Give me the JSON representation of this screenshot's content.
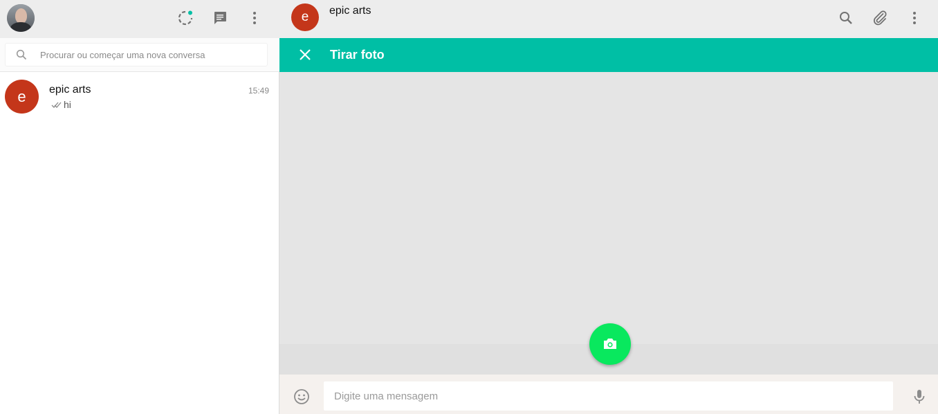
{
  "sidebar": {
    "header": {
      "avatar_icon": "user-avatar-photo",
      "icons": [
        "status-icon",
        "new-chat-icon",
        "menu-icon"
      ],
      "status_dot_color": "#00bfa5"
    },
    "search": {
      "placeholder": "Procurar ou começar uma nova conversa",
      "icon": "search-icon"
    },
    "chats": [
      {
        "avatar_letter": "e",
        "avatar_color": "#c4361a",
        "name": "epic arts",
        "time": "15:49",
        "status_icon": "double-check-icon",
        "preview": "hi"
      }
    ]
  },
  "conversation": {
    "header": {
      "avatar_letter": "e",
      "avatar_color": "#c4361a",
      "name": "epic arts",
      "icons": [
        "search-icon",
        "attach-icon",
        "menu-icon"
      ]
    },
    "photo_panel": {
      "title": "Tirar foto",
      "close_icon": "close-icon",
      "bar_color": "#00bfa5",
      "capture_button_icon": "camera-icon",
      "capture_button_color": "#09e85e"
    },
    "compose": {
      "emoji_icon": "emoji-icon",
      "placeholder": "Digite uma mensagem",
      "mic_icon": "mic-icon"
    }
  }
}
